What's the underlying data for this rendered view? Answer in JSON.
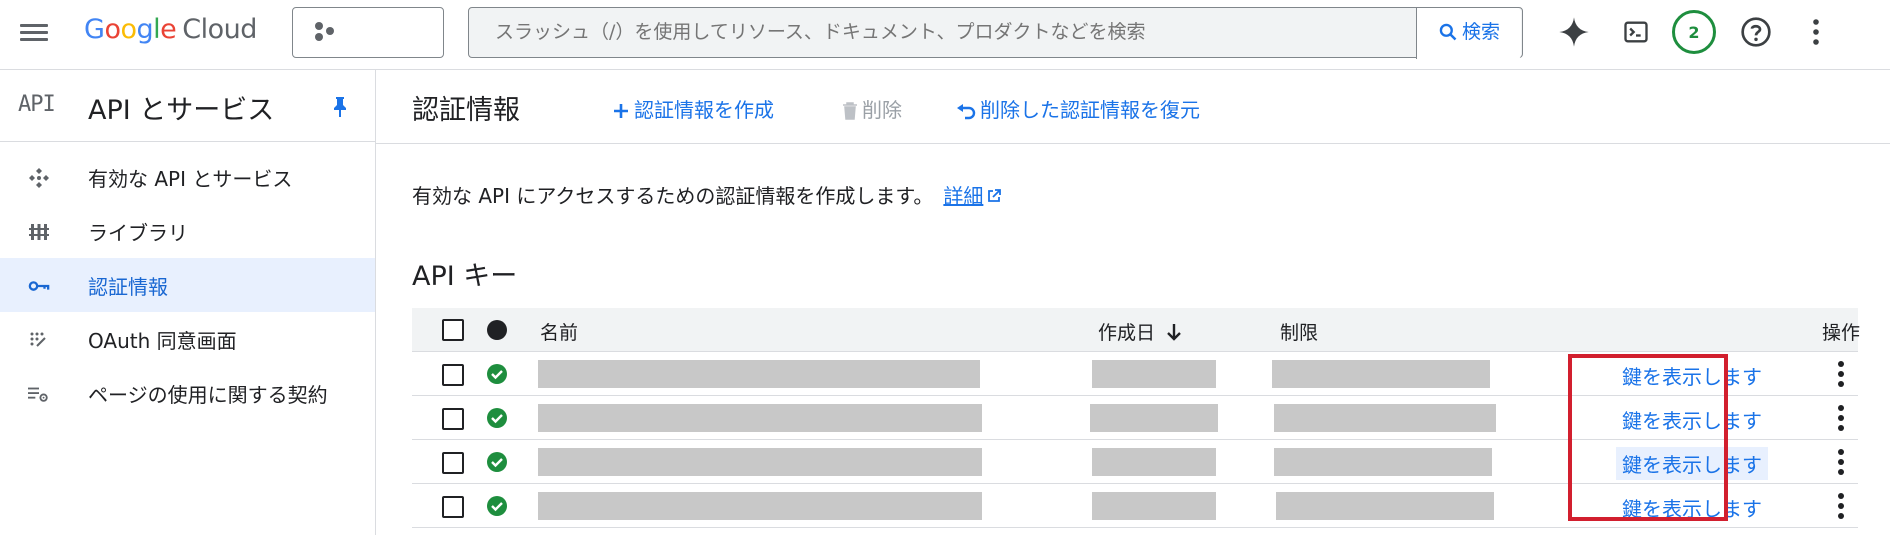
{
  "header": {
    "brand": [
      "G",
      "o",
      "o",
      "g",
      "l",
      "e"
    ],
    "product": "Cloud",
    "search": {
      "placeholder": "スラッシュ（/）を使用してリソース、ドキュメント、プロダクトなどを検索",
      "button_label": "検索"
    },
    "notification_count": "2"
  },
  "sidebar": {
    "mark": "API",
    "title": "API とサービス",
    "items": [
      {
        "label": "有効な API とサービス",
        "icon": "api-diamond-icon"
      },
      {
        "label": "ライブラリ",
        "icon": "library-icon"
      },
      {
        "label": "認証情報",
        "icon": "key-icon",
        "active": true
      },
      {
        "label": "OAuth 同意画面",
        "icon": "oauth-icon"
      },
      {
        "label": "ページの使用に関する契約",
        "icon": "settings-list-icon"
      }
    ]
  },
  "main": {
    "title": "認証情報",
    "actions": {
      "create": "認証情報を作成",
      "delete": "削除",
      "restore": "削除した認証情報を復元"
    },
    "description": "有効な API にアクセスするための認証情報を作成します。",
    "details_link": "詳細",
    "api_keys": {
      "section_title": "API キー",
      "columns": {
        "name": "名前",
        "created": "作成日",
        "restrictions": "制限",
        "actions": "操作"
      },
      "rows": [
        {
          "show_key": "鍵を表示します",
          "status": "ok"
        },
        {
          "show_key": "鍵を表示します",
          "status": "ok"
        },
        {
          "show_key": "鍵を表示します",
          "status": "ok"
        },
        {
          "show_key": "鍵を表示します",
          "status": "ok"
        }
      ]
    }
  },
  "colors": {
    "accent": "#1a73e8",
    "active_bg": "#e8f0fe",
    "status_ok": "#1e8e3e",
    "highlight": "#d21f2e"
  }
}
